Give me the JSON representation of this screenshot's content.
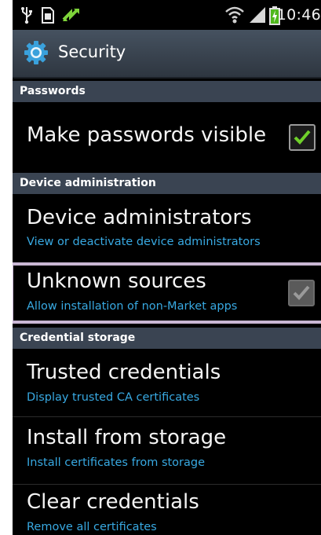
{
  "status_bar": {
    "time": "10:46",
    "icons": [
      "usb-icon",
      "sd-card-icon",
      "sync-icon",
      "wifi-icon",
      "signal-icon",
      "battery-charging-icon"
    ]
  },
  "title_bar": {
    "icon": "gear-icon",
    "title": "Security"
  },
  "sections": {
    "passwords": {
      "header": "Passwords"
    },
    "device_admin": {
      "header": "Device administration"
    },
    "credential_storage": {
      "header": "Credential storage"
    }
  },
  "items": {
    "make_passwords_visible": {
      "title": "Make passwords visible",
      "checked": true
    },
    "device_administrators": {
      "title": "Device administrators",
      "subtitle": "View or deactivate device administrators"
    },
    "unknown_sources": {
      "title": "Unknown sources",
      "subtitle": "Allow installation of non-Market apps",
      "checked": true,
      "disabled": true
    },
    "trusted_credentials": {
      "title": "Trusted credentials",
      "subtitle": "Display trusted CA certificates"
    },
    "install_from_storage": {
      "title": "Install from storage",
      "subtitle": "Install certificates from storage"
    },
    "clear_credentials": {
      "title": "Clear credentials",
      "subtitle": "Remove all certificates"
    }
  },
  "colors": {
    "accent_blue": "#38a9e2",
    "check_green": "#6fd02a",
    "section_header": "#3a4452",
    "highlight": "#c9b7d4"
  }
}
